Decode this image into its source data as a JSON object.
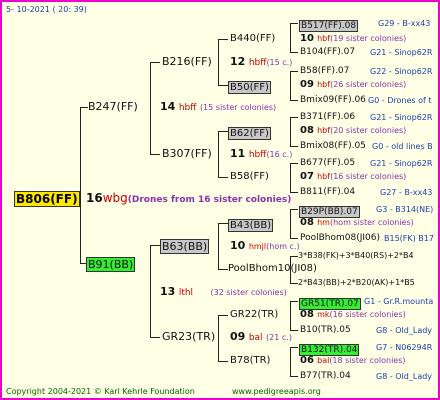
{
  "header": {
    "date": "5- 10-2021 ( 20: 39)"
  },
  "watermark": "",
  "footer": {
    "copyright": "Copyright 2004-2021 © Karl Kehrle Foundation",
    "url": "www.pedigreeapis.org"
  },
  "root": {
    "name": "B806(FF)",
    "num": "16",
    "tag": "wbg",
    "note": "(Drones from 16 sister colonies)"
  },
  "g1": [
    {
      "name": "B247(FF)",
      "num": "14",
      "tag": "hbff",
      "note": "(15 sister colonies)"
    },
    {
      "name": "B91(BB)",
      "num": "13",
      "tag": "lthl",
      "note": "(32 sister colonies)"
    }
  ],
  "g2": [
    {
      "name": "B216(FF)",
      "num": "12",
      "tag": "hbff",
      "note": "(15 c.)"
    },
    {
      "name": "B307(FF)",
      "num": "11",
      "tag": "hbff",
      "note": "(16 c.)"
    },
    {
      "name": "B63(BB)",
      "num": "10",
      "tag": "hmjl",
      "note": "(hom c.)"
    },
    {
      "name": "GR23(TR)",
      "num": "09",
      "tag": "bal",
      "note": "(21 c.)"
    }
  ],
  "g3": [
    {
      "name": "B440(FF)",
      "num": "10",
      "tag": "hbf",
      "note": "(19 sister colonies)"
    },
    {
      "name": "B50(FF)",
      "num": "09",
      "tag": "hbf",
      "note": "(26 sister colonies)"
    },
    {
      "name": "B62(FF)",
      "num": "08",
      "tag": "hbf",
      "note": "(20 sister colonies)"
    },
    {
      "name": "B58(FF)",
      "num": "07",
      "tag": "hbf",
      "note": "(16 sister colonies)"
    },
    {
      "name": "B43(BB)",
      "num": "08",
      "tag": "hm",
      "note": "(hom sister colonies)"
    },
    {
      "name": "PoolBhom10(JI08)",
      "num": "",
      "tag": "",
      "note": ""
    },
    {
      "name": "GR22(TR)",
      "num": "08",
      "tag": "mk",
      "note": "(16 sister colonies)"
    },
    {
      "name": "B78(TR)",
      "num": "06",
      "tag": "bal",
      "note": "(18 sister colonies)"
    }
  ],
  "g4": [
    {
      "name": "B517(FF).08",
      "info": "G29 - B-xx43"
    },
    {
      "name": "B104(FF).07",
      "info": "G21 - Sinop62R"
    },
    {
      "name": "B58(FF).07",
      "info": "G22 - Sinop62R"
    },
    {
      "name": "Bmix09(FF).06",
      "info": "G0 - Drones of t"
    },
    {
      "name": "B371(FF).06",
      "info": "G21 - Sinop62R"
    },
    {
      "name": "Bmix08(FF).05",
      "info": "G0 - old lines B"
    },
    {
      "name": "B677(FF).05",
      "info": "G21 - Sinop62R"
    },
    {
      "name": "B811(FF).04",
      "info": "G27 - B-xx43"
    },
    {
      "name": "B29P(BB).07",
      "info": "G3 - B314(NE)"
    },
    {
      "name": "PoolBhom08(JI06)",
      "info": "B15(FK) B17"
    },
    {
      "name": "3*B38(FK)+3*B40(RS)+2*B4",
      "info": ""
    },
    {
      "name": "2*B43(BB)+2*B20(AK)+1*B5",
      "info": ""
    },
    {
      "name": "GR51(TR).07",
      "info": "G1 - Gr.R.mounta"
    },
    {
      "name": "B10(TR).05",
      "info": "G8 - Old_Lady"
    },
    {
      "name": "B132(TR).04",
      "info": "G7 - N06294R"
    },
    {
      "name": "B77(TR).04",
      "info": "G8 - Old_Lady"
    }
  ],
  "colors": {
    "border": "#ee00cc",
    "root_bg": "#ffe800",
    "grey_bg": "#c8c8c8",
    "green_bg": "#33ee33",
    "blue_text": "#1a3fb0",
    "red_text": "#cc0000"
  }
}
